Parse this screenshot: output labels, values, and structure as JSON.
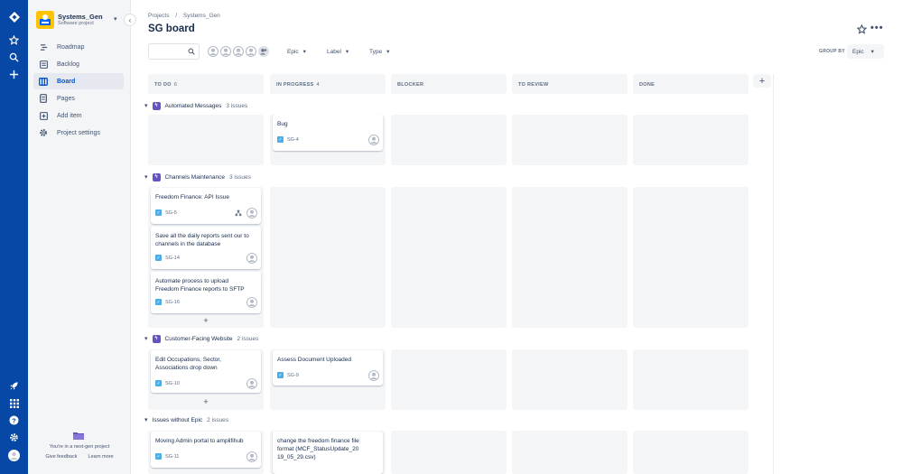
{
  "global_nav": {
    "icons": [
      "jira-logo-icon",
      "star-icon",
      "search-icon",
      "plus-icon"
    ],
    "bottom_icons": [
      "rocket-icon",
      "app-switcher-icon",
      "help-icon",
      "settings-icon",
      "user-avatar-icon"
    ]
  },
  "project": {
    "name": "Systems_Gen",
    "type": "Software project"
  },
  "sidebar": {
    "items": [
      {
        "label": "Roadmap",
        "icon": "roadmap-icon"
      },
      {
        "label": "Backlog",
        "icon": "backlog-icon"
      },
      {
        "label": "Board",
        "icon": "board-icon",
        "active": true
      },
      {
        "label": "Pages",
        "icon": "pages-icon"
      },
      {
        "label": "Add item",
        "icon": "add-item-icon"
      },
      {
        "label": "Project settings",
        "icon": "gear-icon"
      }
    ],
    "next_gen_text": "You're in a next-gen project",
    "give_feedback": "Give feedback",
    "learn_more": "Learn more"
  },
  "header": {
    "breadcrumb_projects": "Projects",
    "breadcrumb_sep": "/",
    "breadcrumb_project": "Systems_Gen",
    "title": "SG board"
  },
  "filters": {
    "epic": "Epic",
    "label": "Label",
    "type": "Type",
    "group_by_label": "GROUP BY",
    "group_by_value": "Epic"
  },
  "columns": [
    {
      "name": "TO DO",
      "count": "6"
    },
    {
      "name": "IN PROGRESS",
      "count": "4"
    },
    {
      "name": "BLOCKER",
      "count": ""
    },
    {
      "name": "TO REVIEW",
      "count": ""
    },
    {
      "name": "DONE",
      "count": ""
    }
  ],
  "swimlanes": [
    {
      "name": "Automated Messages",
      "count": "3 issues"
    },
    {
      "name": "Channels Maintenance",
      "count": "3 issues"
    },
    {
      "name": "Customer-Facing Website",
      "count": "2 issues"
    },
    {
      "name": "Issues without Epic",
      "count": "2 issues"
    }
  ],
  "cards": {
    "sg4": {
      "title": "Bug",
      "key": "SG-4"
    },
    "sg5": {
      "title": "Freedom Finance: API Issue",
      "key": "SG-5"
    },
    "sg14": {
      "title": "Save all the daily reports sent our to channels in the database",
      "key": "SG-14"
    },
    "sg16": {
      "title": "Automate process to upload Freedom Finance reports to SFTP",
      "key": "SG-16"
    },
    "sg10": {
      "title": "Edit Occupations, Sector, Associations drop down",
      "key": "SG-10"
    },
    "sg9": {
      "title": "Assess Document Uploaded",
      "key": "SG-9"
    },
    "sg11": {
      "title": "Moving Admin portal to amplifihub",
      "key": "SG-11"
    },
    "freedom_file": {
      "title": "change the freedom finance file format (MCF_StatusUpdate_2019_05_29.csv)"
    }
  },
  "add_symbol": "+"
}
